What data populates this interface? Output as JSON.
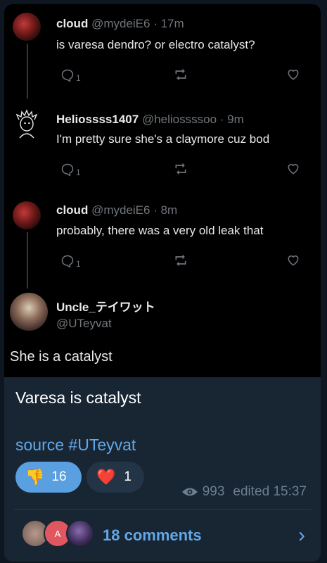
{
  "tweets": [
    {
      "name": "cloud",
      "handle": "@mydeiE6 · 17m",
      "text": "is varesa dendro? or electro catalyst?",
      "reply_count": "1"
    },
    {
      "name": "Heliossss1407",
      "handle": "@heliossssoo · 9m",
      "text": "I'm pretty sure she's a claymore cuz bod",
      "reply_count": "1"
    },
    {
      "name": "cloud",
      "handle": "@mydeiE6 · 8m",
      "text": "probably, there was a very old leak that",
      "reply_count": "1"
    }
  ],
  "quoted": {
    "name": "Uncle_テイワット",
    "handle": "@UTeyvat",
    "text": "She is a catalyst"
  },
  "post": {
    "caption": "Varesa is catalyst",
    "source": "source #UTeyvat",
    "reactions": [
      {
        "emoji": "👎",
        "count": "16"
      },
      {
        "emoji": "❤️",
        "count": "1"
      }
    ],
    "views": "993",
    "edited": "edited 15:37",
    "comments_label": "18 comments",
    "comment_avatar_letter": "A"
  },
  "colors": {
    "link": "#62a8e8",
    "bubble": "#182533",
    "reaction_active": "#5a9fe0"
  }
}
